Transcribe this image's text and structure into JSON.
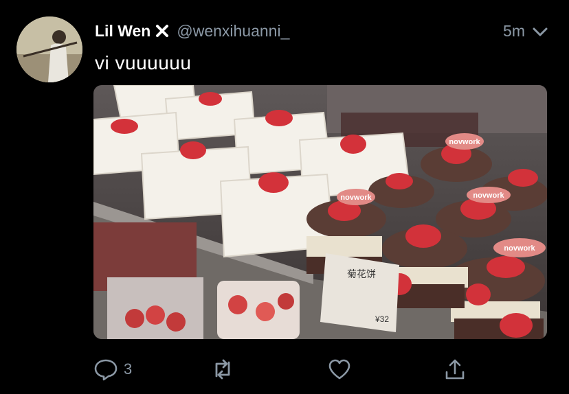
{
  "tweet": {
    "author_name": "Lil Wen",
    "handle": "@wenxihuanni_",
    "time": "5m",
    "text": "vi vuuuuuu"
  },
  "media": {
    "signs": [
      "novwork",
      "novwork",
      "novwork",
      "novwork"
    ],
    "price_card": {
      "title": "菊花饼",
      "price": "¥32"
    }
  },
  "actions": {
    "reply_count": "3"
  },
  "colors": {
    "background": "#000000",
    "text": "#ffffff",
    "secondary": "#8b98a5"
  },
  "icons": [
    "verified-icon",
    "chevron-down-icon",
    "reply-icon",
    "retweet-icon",
    "like-icon",
    "share-icon"
  ]
}
